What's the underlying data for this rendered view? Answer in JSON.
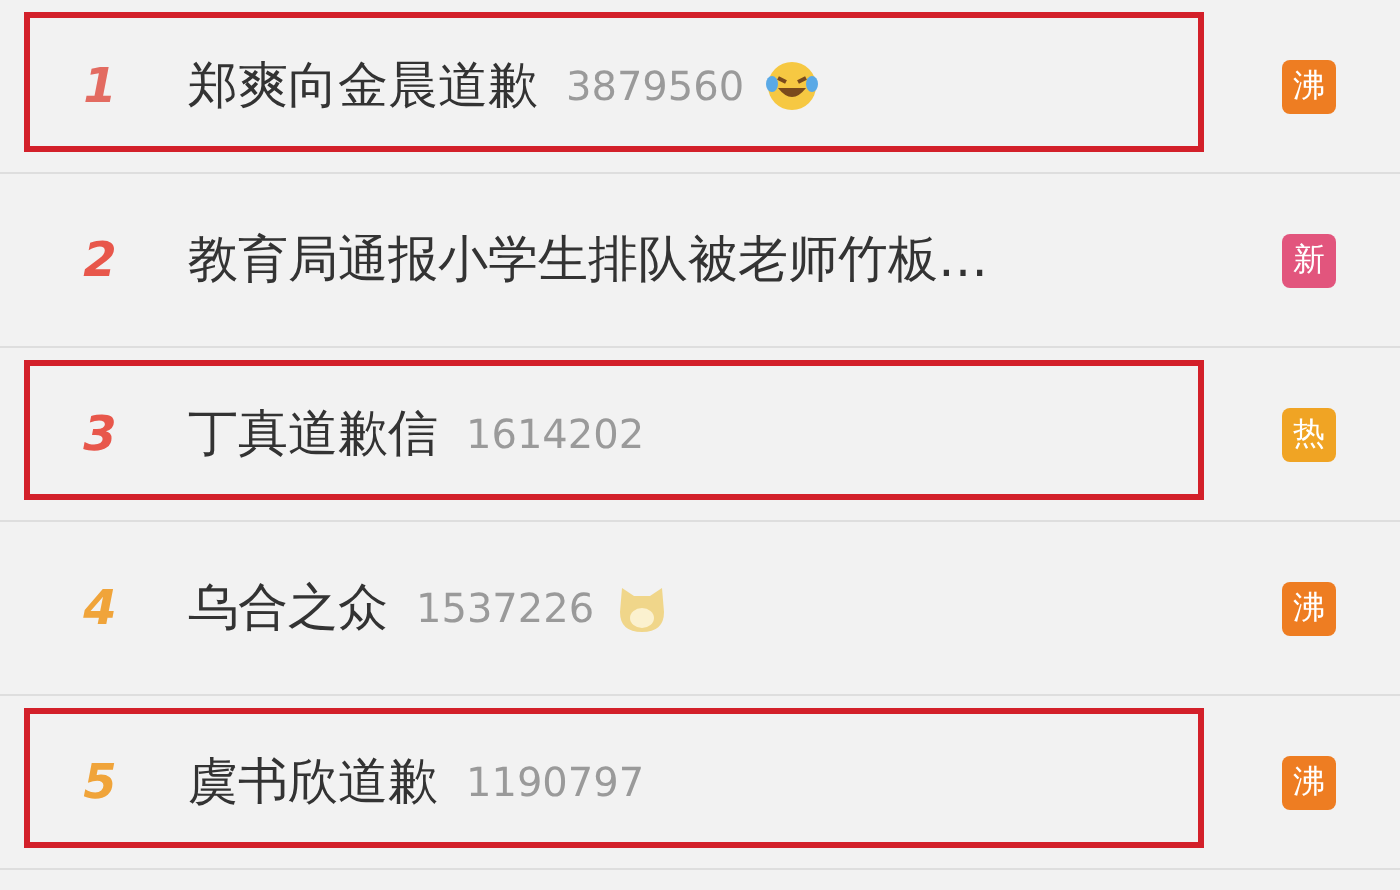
{
  "hot_list": [
    {
      "rank": "1",
      "color": "#e36b61",
      "title": "郑爽向金晨道歉",
      "count": "3879560",
      "emoji": {
        "kind": "laugh-cry"
      },
      "badge": {
        "label": "沸",
        "color": "#ee7d22"
      },
      "highlighted": true
    },
    {
      "rank": "2",
      "color": "#e8574b",
      "title": "教育局通报小学生排队被老师竹板…",
      "badge": {
        "label": "新",
        "color": "#e2557d"
      },
      "highlighted": false
    },
    {
      "rank": "3",
      "color": "#e8574b",
      "title": "丁真道歉信",
      "count": "1614202",
      "badge": {
        "label": "热",
        "color": "#f0a424"
      },
      "highlighted": true
    },
    {
      "rank": "4",
      "color": "#f0a43a",
      "title": "乌合之众",
      "count": "1537226",
      "emoji": {
        "kind": "dog"
      },
      "badge": {
        "label": "沸",
        "color": "#ee7d22"
      },
      "highlighted": false
    },
    {
      "rank": "5",
      "color": "#f0a43a",
      "title": "虞书欣道歉",
      "count": "1190797",
      "badge": {
        "label": "沸",
        "color": "#ee7d22"
      },
      "highlighted": true
    }
  ]
}
